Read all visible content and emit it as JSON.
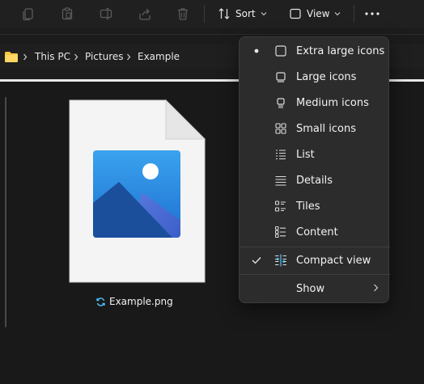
{
  "toolbar": {
    "icons": [
      "copy-icon",
      "paste-icon",
      "rename-icon",
      "share-icon",
      "delete-icon"
    ],
    "sort_label": "Sort",
    "view_label": "View",
    "more_icon": "more-icon"
  },
  "breadcrumb": {
    "items": [
      "This PC",
      "Pictures",
      "Example"
    ]
  },
  "file": {
    "name": "Example.png",
    "sync_icon": "sync-icon",
    "type_icon": "image-icon"
  },
  "view_menu": {
    "items": [
      {
        "label": "Extra large icons",
        "icon": "extra-large-icons-icon",
        "selected": true
      },
      {
        "label": "Large icons",
        "icon": "large-icons-icon",
        "selected": false
      },
      {
        "label": "Medium icons",
        "icon": "medium-icons-icon",
        "selected": false
      },
      {
        "label": "Small icons",
        "icon": "small-icons-icon",
        "selected": false
      },
      {
        "label": "List",
        "icon": "list-icon",
        "selected": false
      },
      {
        "label": "Details",
        "icon": "details-icon",
        "selected": false
      },
      {
        "label": "Tiles",
        "icon": "tiles-icon",
        "selected": false
      },
      {
        "label": "Content",
        "icon": "content-icon",
        "selected": false
      }
    ],
    "compact": {
      "label": "Compact view",
      "checked": true,
      "icon": "compact-view-icon"
    },
    "show": {
      "label": "Show",
      "icon": "chevron-right-icon"
    }
  },
  "colors": {
    "accent": "#4cc2ff",
    "menu_bg": "#2c2c2c",
    "folder": "#f7c844",
    "image_blue": "#2a7ed6"
  }
}
